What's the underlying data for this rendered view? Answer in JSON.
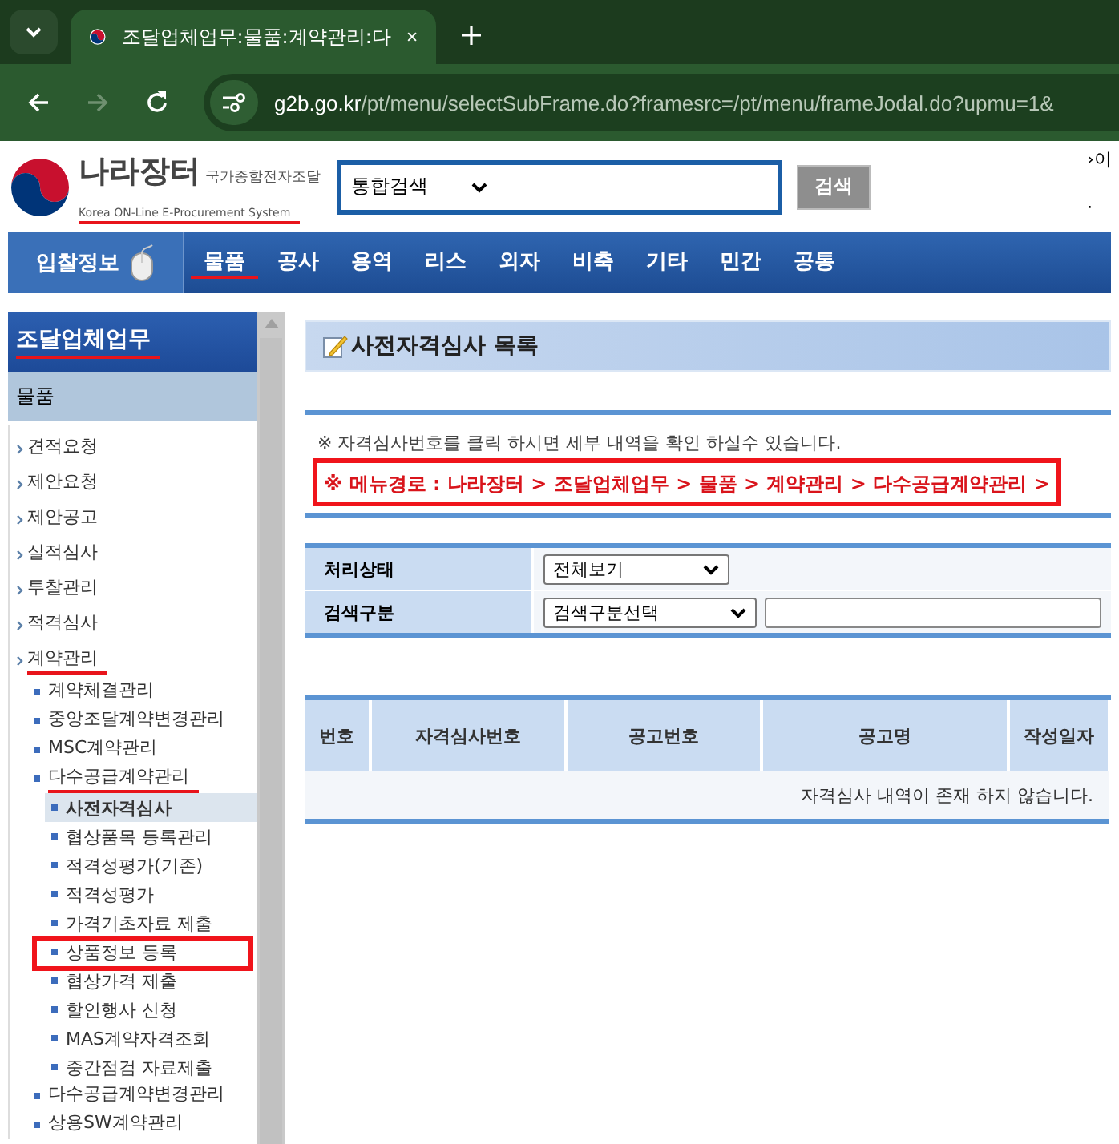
{
  "browser": {
    "tab": {
      "title": "조달업체업무:물품:계약관리:다",
      "selected": true
    },
    "url_host": "g2b.go.kr",
    "url_path": "/pt/menu/selectSubFrame.do?framesrc=/pt/menu/frameJodal.do?upmu=1&",
    "forward_disabled": true
  },
  "header": {
    "logo_title": "나라장터",
    "logo_subtitle": "국가종합전자조달",
    "logo_english": "Korea ON-Line E-Procurement System",
    "logo_underlined": true,
    "search_select": "통합검색",
    "search_button": "검색",
    "right_links": [
      "›이",
      "·"
    ]
  },
  "nav": {
    "home": "입찰정보",
    "items": [
      {
        "label": "물품",
        "underlined": true
      },
      {
        "label": "공사",
        "underlined": false
      },
      {
        "label": "용역",
        "underlined": false
      },
      {
        "label": "리스",
        "underlined": false
      },
      {
        "label": "외자",
        "underlined": false
      },
      {
        "label": "비축",
        "underlined": false
      },
      {
        "label": "기타",
        "underlined": false
      },
      {
        "label": "민간",
        "underlined": false
      },
      {
        "label": "공통",
        "underlined": false
      }
    ]
  },
  "sidebar": {
    "title": "조달업체업무",
    "title_underlined": true,
    "section": "물품",
    "items": [
      {
        "label": "견적요청",
        "underlined": false
      },
      {
        "label": "제안요청",
        "underlined": false
      },
      {
        "label": "제안공고",
        "underlined": false
      },
      {
        "label": "실적심사",
        "underlined": false
      },
      {
        "label": "투찰관리",
        "underlined": false
      },
      {
        "label": "적격심사",
        "underlined": false
      },
      {
        "label": "계약관리",
        "underlined": true,
        "children": [
          {
            "label": "계약체결관리",
            "underlined": false
          },
          {
            "label": "중앙조달계약변경관리",
            "underlined": false
          },
          {
            "label": "MSC계약관리",
            "underlined": false
          },
          {
            "label": "다수공급계약관리",
            "underlined": true,
            "children": [
              {
                "label": "사전자격심사",
                "selected": true,
                "boxed": false
              },
              {
                "label": "협상품목 등록관리",
                "selected": false,
                "boxed": false
              },
              {
                "label": "적격성평가(기존)",
                "selected": false,
                "boxed": false
              },
              {
                "label": "적격성평가",
                "selected": false,
                "boxed": false
              },
              {
                "label": "가격기초자료 제출",
                "selected": false,
                "boxed": false
              },
              {
                "label": "상품정보 등록",
                "selected": false,
                "boxed": true
              },
              {
                "label": "협상가격 제출",
                "selected": false,
                "boxed": false
              },
              {
                "label": "할인행사 신청",
                "selected": false,
                "boxed": false
              },
              {
                "label": "MAS계약자격조회",
                "selected": false,
                "boxed": false
              },
              {
                "label": "중간점검 자료제출",
                "selected": false,
                "boxed": false
              }
            ]
          },
          {
            "label": "다수공급계약변경관리",
            "underlined": false
          },
          {
            "label": "상용SW계약관리",
            "underlined": false
          }
        ]
      }
    ]
  },
  "page": {
    "title": "사전자격심사 목록",
    "note": "※ 자격심사번호를 클릭 하시면 세부 내역을 확인 하실수 있습니다.",
    "breadcrumb": "※ 메뉴경로 : 나라장터 > 조달업체업무 > 물품 > 계약관리 > 다수공급계약관리 >",
    "breadcrumb_boxed": true
  },
  "filters": [
    {
      "label": "처리상태",
      "select": "전체보기",
      "kind": "select"
    },
    {
      "label": "검색구분",
      "select": "검색구분선택",
      "kind": "select-input"
    }
  ],
  "table": {
    "columns": [
      "번호",
      "자격심사번호",
      "공고번호",
      "공고명",
      "작성일자"
    ],
    "empty_message": "자격심사 내역이 존재 하지 않습니다."
  }
}
